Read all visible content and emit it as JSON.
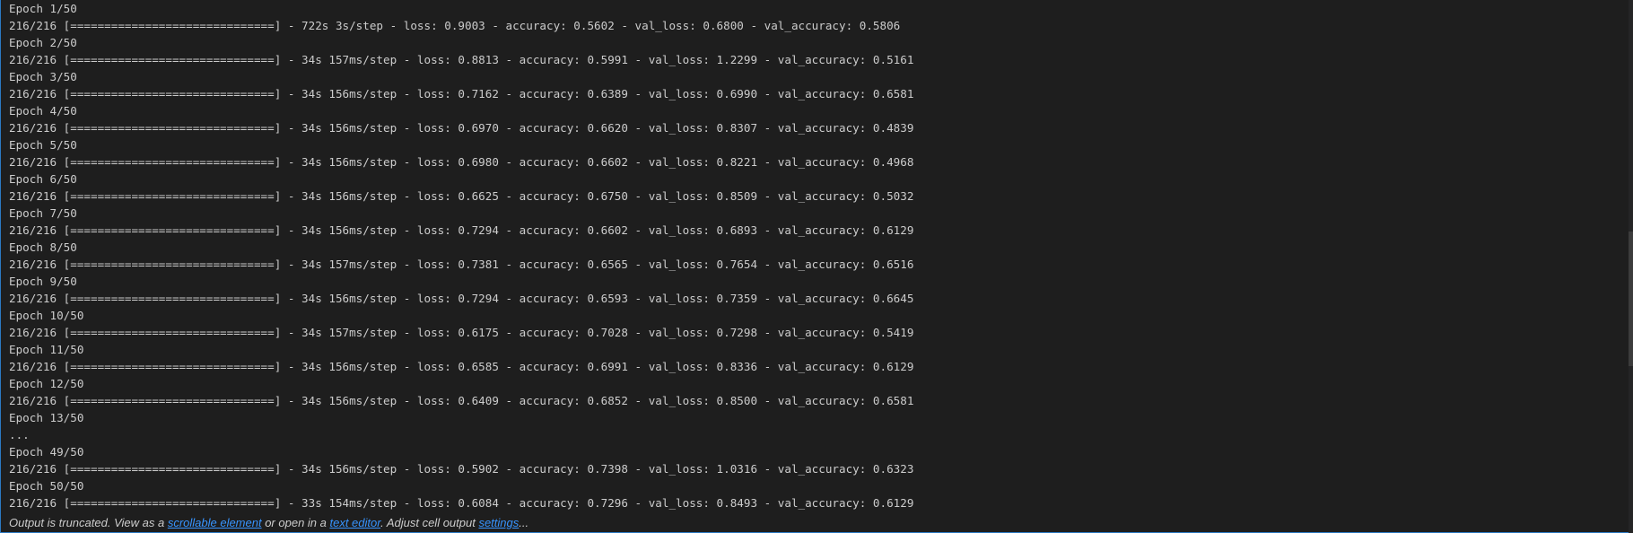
{
  "output": {
    "lines": [
      "Epoch 1/50",
      "216/216 [==============================] - 722s 3s/step - loss: 0.9003 - accuracy: 0.5602 - val_loss: 0.6800 - val_accuracy: 0.5806",
      "Epoch 2/50",
      "216/216 [==============================] - 34s 157ms/step - loss: 0.8813 - accuracy: 0.5991 - val_loss: 1.2299 - val_accuracy: 0.5161",
      "Epoch 3/50",
      "216/216 [==============================] - 34s 156ms/step - loss: 0.7162 - accuracy: 0.6389 - val_loss: 0.6990 - val_accuracy: 0.6581",
      "Epoch 4/50",
      "216/216 [==============================] - 34s 156ms/step - loss: 0.6970 - accuracy: 0.6620 - val_loss: 0.8307 - val_accuracy: 0.4839",
      "Epoch 5/50",
      "216/216 [==============================] - 34s 156ms/step - loss: 0.6980 - accuracy: 0.6602 - val_loss: 0.8221 - val_accuracy: 0.4968",
      "Epoch 6/50",
      "216/216 [==============================] - 34s 156ms/step - loss: 0.6625 - accuracy: 0.6750 - val_loss: 0.8509 - val_accuracy: 0.5032",
      "Epoch 7/50",
      "216/216 [==============================] - 34s 156ms/step - loss: 0.7294 - accuracy: 0.6602 - val_loss: 0.6893 - val_accuracy: 0.6129",
      "Epoch 8/50",
      "216/216 [==============================] - 34s 157ms/step - loss: 0.7381 - accuracy: 0.6565 - val_loss: 0.7654 - val_accuracy: 0.6516",
      "Epoch 9/50",
      "216/216 [==============================] - 34s 156ms/step - loss: 0.7294 - accuracy: 0.6593 - val_loss: 0.7359 - val_accuracy: 0.6645",
      "Epoch 10/50",
      "216/216 [==============================] - 34s 157ms/step - loss: 0.6175 - accuracy: 0.7028 - val_loss: 0.7298 - val_accuracy: 0.5419",
      "Epoch 11/50",
      "216/216 [==============================] - 34s 156ms/step - loss: 0.6585 - accuracy: 0.6991 - val_loss: 0.8336 - val_accuracy: 0.6129",
      "Epoch 12/50",
      "216/216 [==============================] - 34s 156ms/step - loss: 0.6409 - accuracy: 0.6852 - val_loss: 0.8500 - val_accuracy: 0.6581",
      "Epoch 13/50",
      "...",
      "Epoch 49/50",
      "216/216 [==============================] - 34s 156ms/step - loss: 0.5902 - accuracy: 0.7398 - val_loss: 1.0316 - val_accuracy: 0.6323",
      "Epoch 50/50",
      "216/216 [==============================] - 33s 154ms/step - loss: 0.6084 - accuracy: 0.7296 - val_loss: 0.8493 - val_accuracy: 0.6129"
    ]
  },
  "notice": {
    "prefix": "Output is truncated. View as a ",
    "scrollable_link": "scrollable element",
    "middle": " or open in a ",
    "editor_link": "text editor",
    "after_editor": ". Adjust cell output ",
    "settings_link": "settings",
    "suffix": "..."
  },
  "colors": {
    "background": "#1e1e1e",
    "text": "#cccccc",
    "link": "#3794ff",
    "focus_border": "#2b79c2"
  }
}
